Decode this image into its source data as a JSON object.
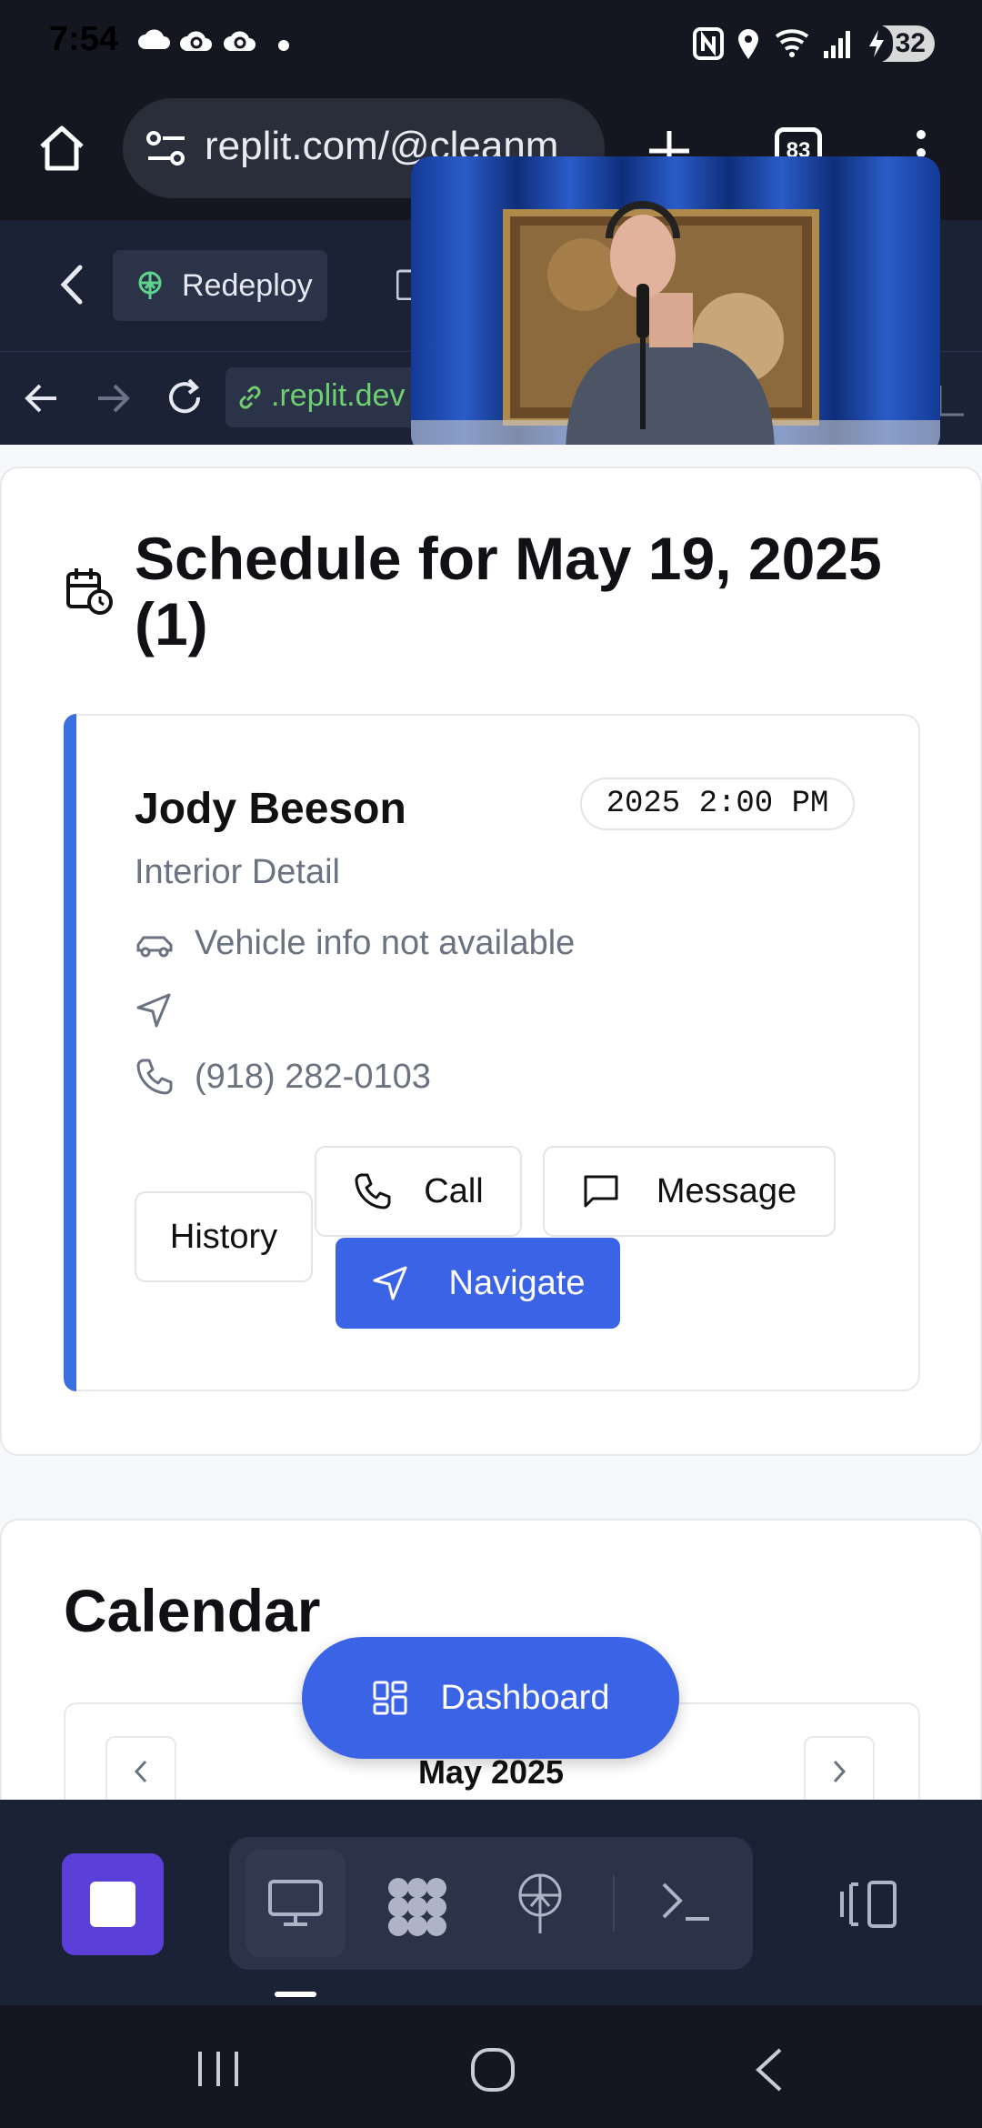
{
  "status_bar": {
    "time": "7:54",
    "battery": "32"
  },
  "browser": {
    "url": "replit.com/@cleanm",
    "tab_count": "83"
  },
  "replit": {
    "redeploy_label": "Redeploy",
    "dev_url": ".replit.dev"
  },
  "schedule": {
    "title": "Schedule for May 19, 2025 (1)",
    "appointment": {
      "client_name": "Jody Beeson",
      "service": "Interior Detail",
      "time": "2025 2:00 PM",
      "vehicle": "Vehicle info not available",
      "address": "",
      "phone": "(918) 282-0103",
      "buttons": {
        "history": "History",
        "call": "Call",
        "message": "Message",
        "navigate": "Navigate"
      }
    }
  },
  "calendar": {
    "title": "Calendar",
    "month": "May 2025"
  },
  "fab": {
    "label": "Dashboard"
  },
  "colors": {
    "accent": "#3b63e6",
    "toolbar_bg": "#1c2236",
    "stop_button": "#5b3fd9"
  }
}
